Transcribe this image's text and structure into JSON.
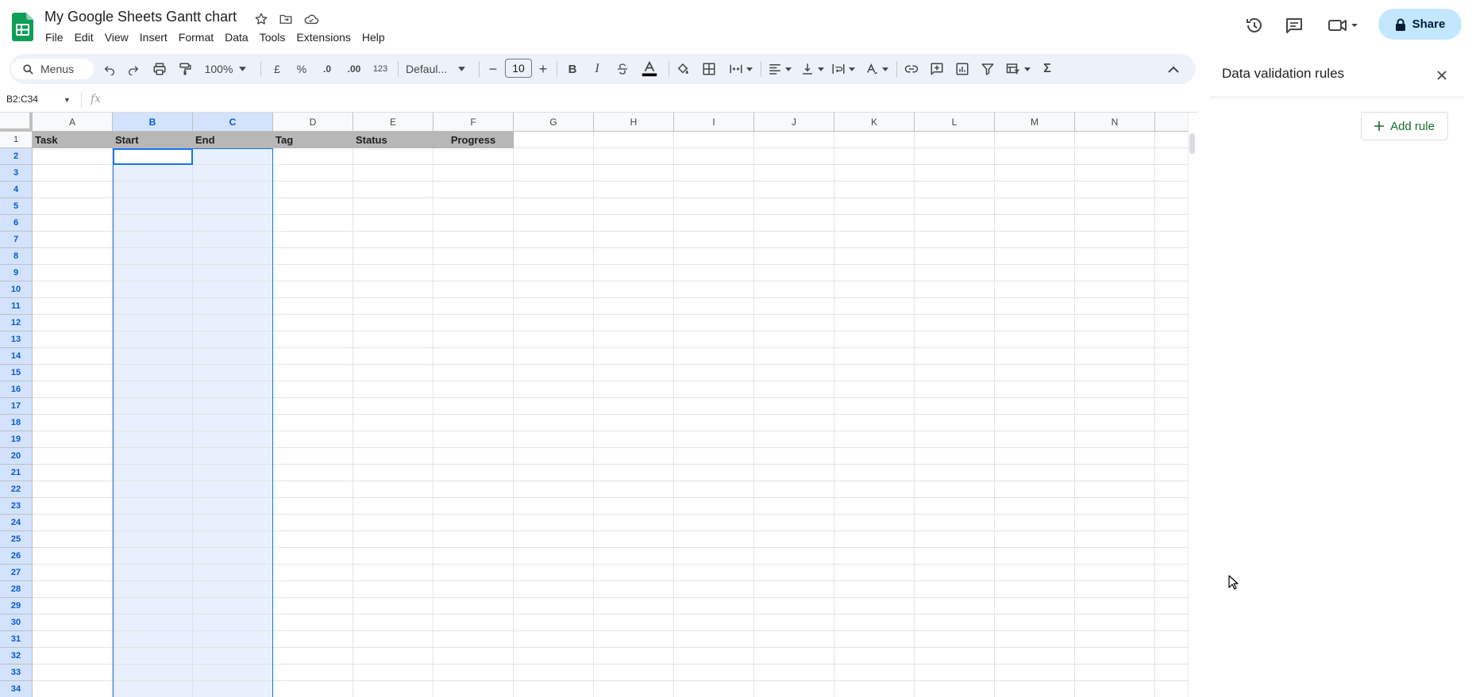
{
  "app": {
    "title": "My Google Sheets Gantt chart",
    "menus": [
      "File",
      "Edit",
      "View",
      "Insert",
      "Format",
      "Data",
      "Tools",
      "Extensions",
      "Help"
    ],
    "share_label": "Share",
    "accent": "#c2e7ff"
  },
  "toolbar": {
    "menus_search": "Menus",
    "zoom": "100%",
    "currency": "£",
    "percent": "%",
    "dec_decrease": ".0",
    "dec_increase": ".00",
    "number_format": "123",
    "font": "Defaul...",
    "font_size": "10",
    "minus": "−",
    "plus": "+"
  },
  "formula_bar": {
    "name_box": "B2:C34",
    "fx": "fx"
  },
  "sheet": {
    "columns": [
      "A",
      "B",
      "C",
      "D",
      "E",
      "F",
      "G",
      "H",
      "I",
      "J",
      "K",
      "L",
      "M",
      "N"
    ],
    "selected_columns": [
      "B",
      "C"
    ],
    "rows": [
      "1",
      "2",
      "3",
      "4",
      "5",
      "6",
      "7",
      "8",
      "9",
      "10",
      "11",
      "12",
      "13",
      "14",
      "15",
      "16",
      "17",
      "18",
      "19",
      "20",
      "21",
      "22",
      "23",
      "24",
      "25",
      "26",
      "27",
      "28",
      "29",
      "30",
      "31",
      "32",
      "33",
      "34"
    ],
    "selected_range": "B2:C34",
    "header_row": [
      "Task",
      "Start",
      "End",
      "Tag",
      "Status",
      "Progress"
    ],
    "header_fill": "#b7b7b7",
    "selection_color": "#1a73e8"
  },
  "panel": {
    "title": "Data validation rules",
    "add_rule": "Add rule"
  }
}
